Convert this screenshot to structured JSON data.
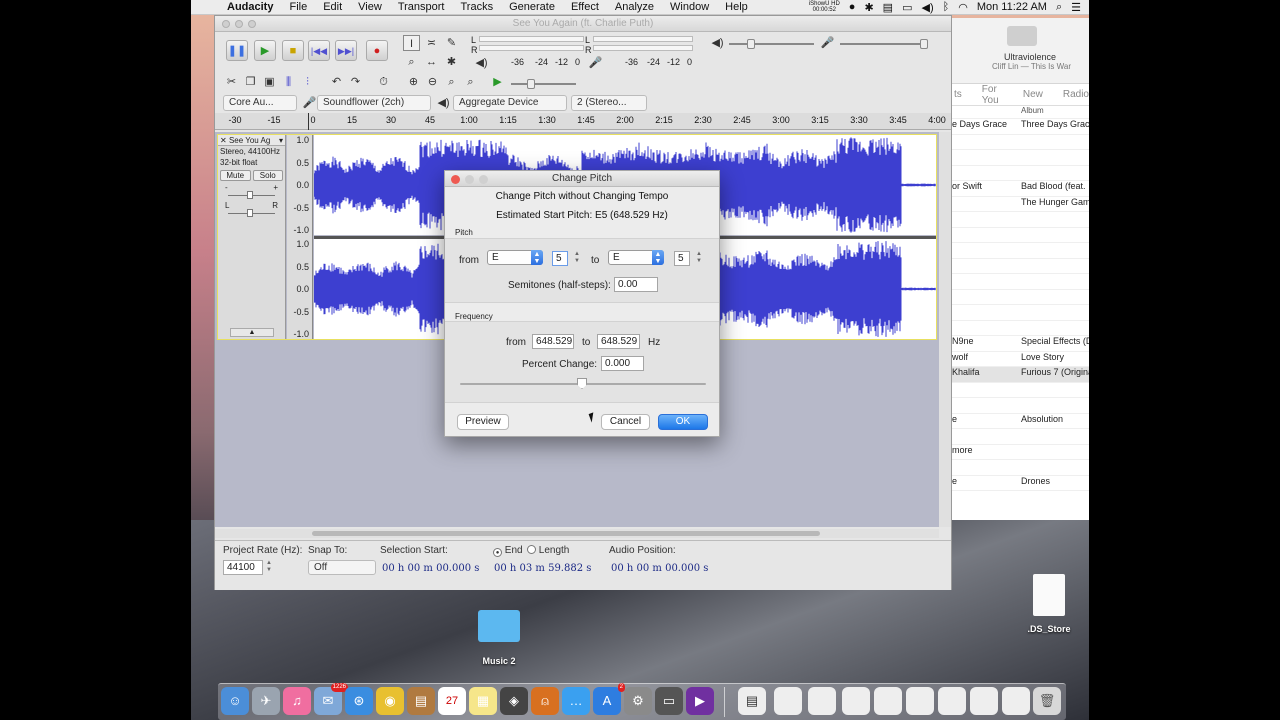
{
  "menubar": {
    "app": "Audacity",
    "items": [
      "File",
      "Edit",
      "View",
      "Transport",
      "Tracks",
      "Generate",
      "Effect",
      "Analyze",
      "Window",
      "Help"
    ],
    "recorder_line1": "iShowU HD",
    "recorder_line2": "00:00:52",
    "clock": "Mon 11:22 AM"
  },
  "itunes": {
    "now_playing_title": "Ultraviolence",
    "now_playing_sub": "Cliff Lin — This Is War",
    "tabs": [
      "ts",
      "For You",
      "New",
      "Radio"
    ],
    "album_header": "Album",
    "rows": [
      {
        "a": "e Days Grace",
        "b": "Three Days Grac"
      },
      {
        "a": "",
        "b": ""
      },
      {
        "a": "",
        "b": ""
      },
      {
        "a": "",
        "b": ""
      },
      {
        "a": "or Swift",
        "b": "Bad Blood (feat."
      },
      {
        "a": "",
        "b": "The Hunger Gam"
      },
      {
        "a": "",
        "b": ""
      },
      {
        "a": "",
        "b": ""
      },
      {
        "a": "",
        "b": ""
      },
      {
        "a": "",
        "b": ""
      },
      {
        "a": "",
        "b": ""
      },
      {
        "a": "",
        "b": ""
      },
      {
        "a": "",
        "b": ""
      },
      {
        "a": "",
        "b": ""
      },
      {
        "a": "N9ne",
        "b": "Special Effects (D"
      },
      {
        "a": "wolf",
        "b": "Love Story"
      },
      {
        "a": "Khalifa",
        "b": "Furious 7 (Origina"
      },
      {
        "a": "",
        "b": ""
      },
      {
        "a": "",
        "b": ""
      },
      {
        "a": "e",
        "b": "Absolution"
      },
      {
        "a": "",
        "b": ""
      },
      {
        "a": "more",
        "b": ""
      },
      {
        "a": "",
        "b": ""
      },
      {
        "a": "e",
        "b": "Drones"
      }
    ]
  },
  "audacity": {
    "title": "See You Again (ft. Charlie Puth)",
    "meter_labels": [
      "-36",
      "-24",
      "-12",
      "0"
    ],
    "device_host": "Core Au...",
    "device_record": "Soundflower (2ch)",
    "device_play": "Aggregate Device",
    "device_channels": "2 (Stereo...",
    "ruler": [
      "-30",
      "-15",
      "0",
      "15",
      "30",
      "45",
      "1:00",
      "1:15",
      "1:30",
      "1:45",
      "2:00",
      "2:15",
      "2:30",
      "2:45",
      "3:00",
      "3:15",
      "3:30",
      "3:45",
      "4:00"
    ],
    "track": {
      "name": "See You Ag",
      "format1": "Stereo, 44100Hz",
      "format2": "32-bit float",
      "mute": "Mute",
      "solo": "Solo",
      "gain_minus": "-",
      "gain_plus": "+",
      "pan_l": "L",
      "pan_r": "R",
      "scale": [
        "1.0",
        "0.5",
        "0.0",
        "-0.5",
        "-1.0"
      ]
    },
    "selection_bar": {
      "project_rate_label": "Project Rate (Hz):",
      "project_rate": "44100",
      "snap_label": "Snap To:",
      "snap_value": "Off",
      "sel_start_label": "Selection Start:",
      "end_label": "End",
      "length_label": "Length",
      "audio_pos_label": "Audio Position:",
      "sel_start": "00 h 00 m 00.000 s",
      "sel_end": "00 h 03 m 59.882 s",
      "audio_pos": "00 h 00 m 00.000 s"
    }
  },
  "dialog": {
    "title": "Change Pitch",
    "heading": "Change Pitch without Changing Tempo",
    "estimated": "Estimated Start Pitch: E5 (648.529 Hz)",
    "pitch_label": "Pitch",
    "from_label": "from",
    "to_label": "to",
    "from_note": "E",
    "from_octave": "5",
    "to_note": "E",
    "to_octave": "5",
    "semitones_label": "Semitones (half-steps):",
    "semitones": "0.00",
    "frequency_label": "Frequency",
    "freq_from": "648.529",
    "freq_to": "648.529",
    "hz": "Hz",
    "percent_label": "Percent Change:",
    "percent": "0.000",
    "preview": "Preview",
    "cancel": "Cancel",
    "ok": "OK"
  },
  "desktop": {
    "folder": "Music 2",
    "file": ".DS_Store"
  },
  "dock_badges": {
    "mail": "1226",
    "appstore": "2",
    "calendar_day": "27"
  },
  "colors": {
    "waveform": "#3d3fd0",
    "ok_button": "#1d77e8",
    "track_highlight": "#e8e060"
  }
}
